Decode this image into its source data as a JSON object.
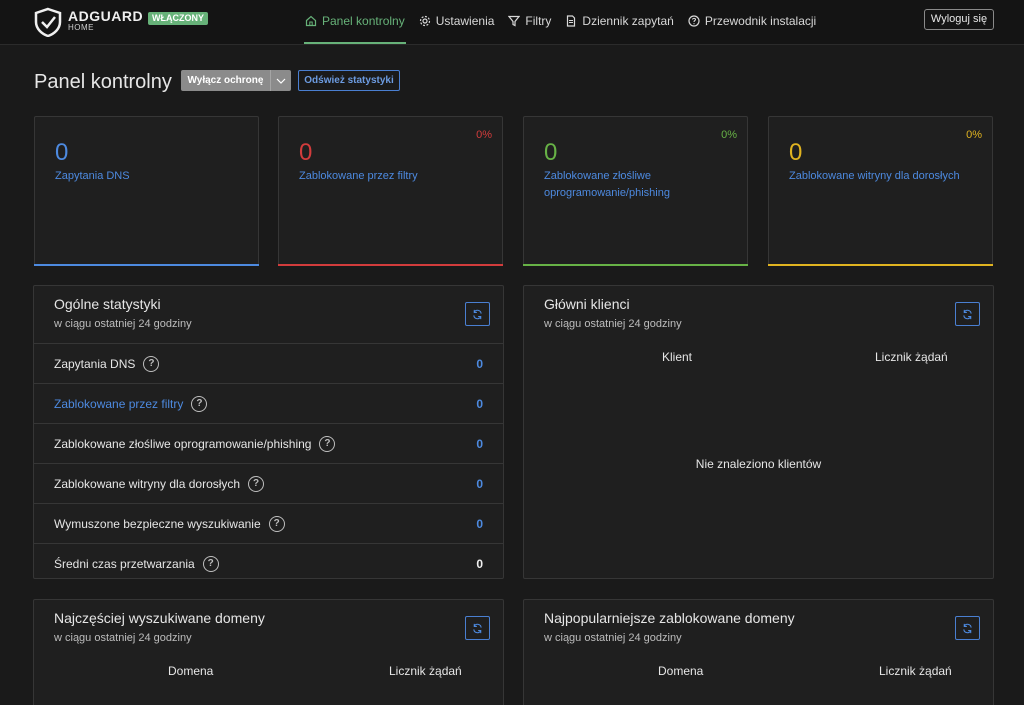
{
  "header": {
    "brand_name": "ADGUARD",
    "brand_sub": "HOME",
    "status": "WŁĄCZONY",
    "nav": [
      {
        "label": "Panel kontrolny",
        "icon": "home-icon",
        "active": true
      },
      {
        "label": "Ustawienia",
        "icon": "gear-icon"
      },
      {
        "label": "Filtry",
        "icon": "filter-icon"
      },
      {
        "label": "Dziennik zapytań",
        "icon": "document-icon"
      },
      {
        "label": "Przewodnik instalacji",
        "icon": "help-circle-icon"
      }
    ],
    "logout": "Wyloguj się"
  },
  "page": {
    "title": "Panel kontrolny",
    "protect_button": "Wyłącz ochronę",
    "refresh_stats_button": "Odśwież statystyki"
  },
  "cards": [
    {
      "value": "0",
      "label": "Zapytania DNS",
      "percent": "",
      "color": "#4d8ae0"
    },
    {
      "value": "0",
      "label": "Zablokowane przez filtry",
      "percent": "0%",
      "color": "#d23c3c"
    },
    {
      "value": "0",
      "label": "Zablokowane złośliwe oprogramowanie/phishing",
      "percent": "0%",
      "color": "#67b246"
    },
    {
      "value": "0",
      "label": "Zablokowane witryny dla dorosłych",
      "percent": "0%",
      "color": "#e0b320"
    }
  ],
  "general_stats": {
    "title": "Ogólne statystyki",
    "subtitle": "w ciągu ostatniej 24 godziny",
    "rows": [
      {
        "label": "Zapytania DNS",
        "value": "0"
      },
      {
        "label": "Zablokowane przez filtry",
        "value": "0"
      },
      {
        "label": "Zablokowane złośliwe oprogramowanie/phishing",
        "value": "0"
      },
      {
        "label": "Zablokowane witryny dla dorosłych",
        "value": "0"
      },
      {
        "label": "Wymuszone bezpieczne wyszukiwanie",
        "value": "0"
      },
      {
        "label": "Średni czas przetwarzania",
        "value": "0"
      }
    ]
  },
  "top_clients": {
    "title": "Główni klienci",
    "subtitle": "w ciągu ostatniej 24 godziny",
    "col_client": "Klient",
    "col_count": "Licznik żądań",
    "empty": "Nie znaleziono klientów"
  },
  "top_queried": {
    "title": "Najczęściej wyszukiwane domeny",
    "subtitle": "w ciągu ostatniej 24 godziny",
    "col_domain": "Domena",
    "col_count": "Licznik żądań"
  },
  "top_blocked": {
    "title": "Najpopularniejsze zablokowane domeny",
    "subtitle": "w ciągu ostatniej 24 godziny",
    "col_domain": "Domena",
    "col_count": "Licznik żądań"
  }
}
